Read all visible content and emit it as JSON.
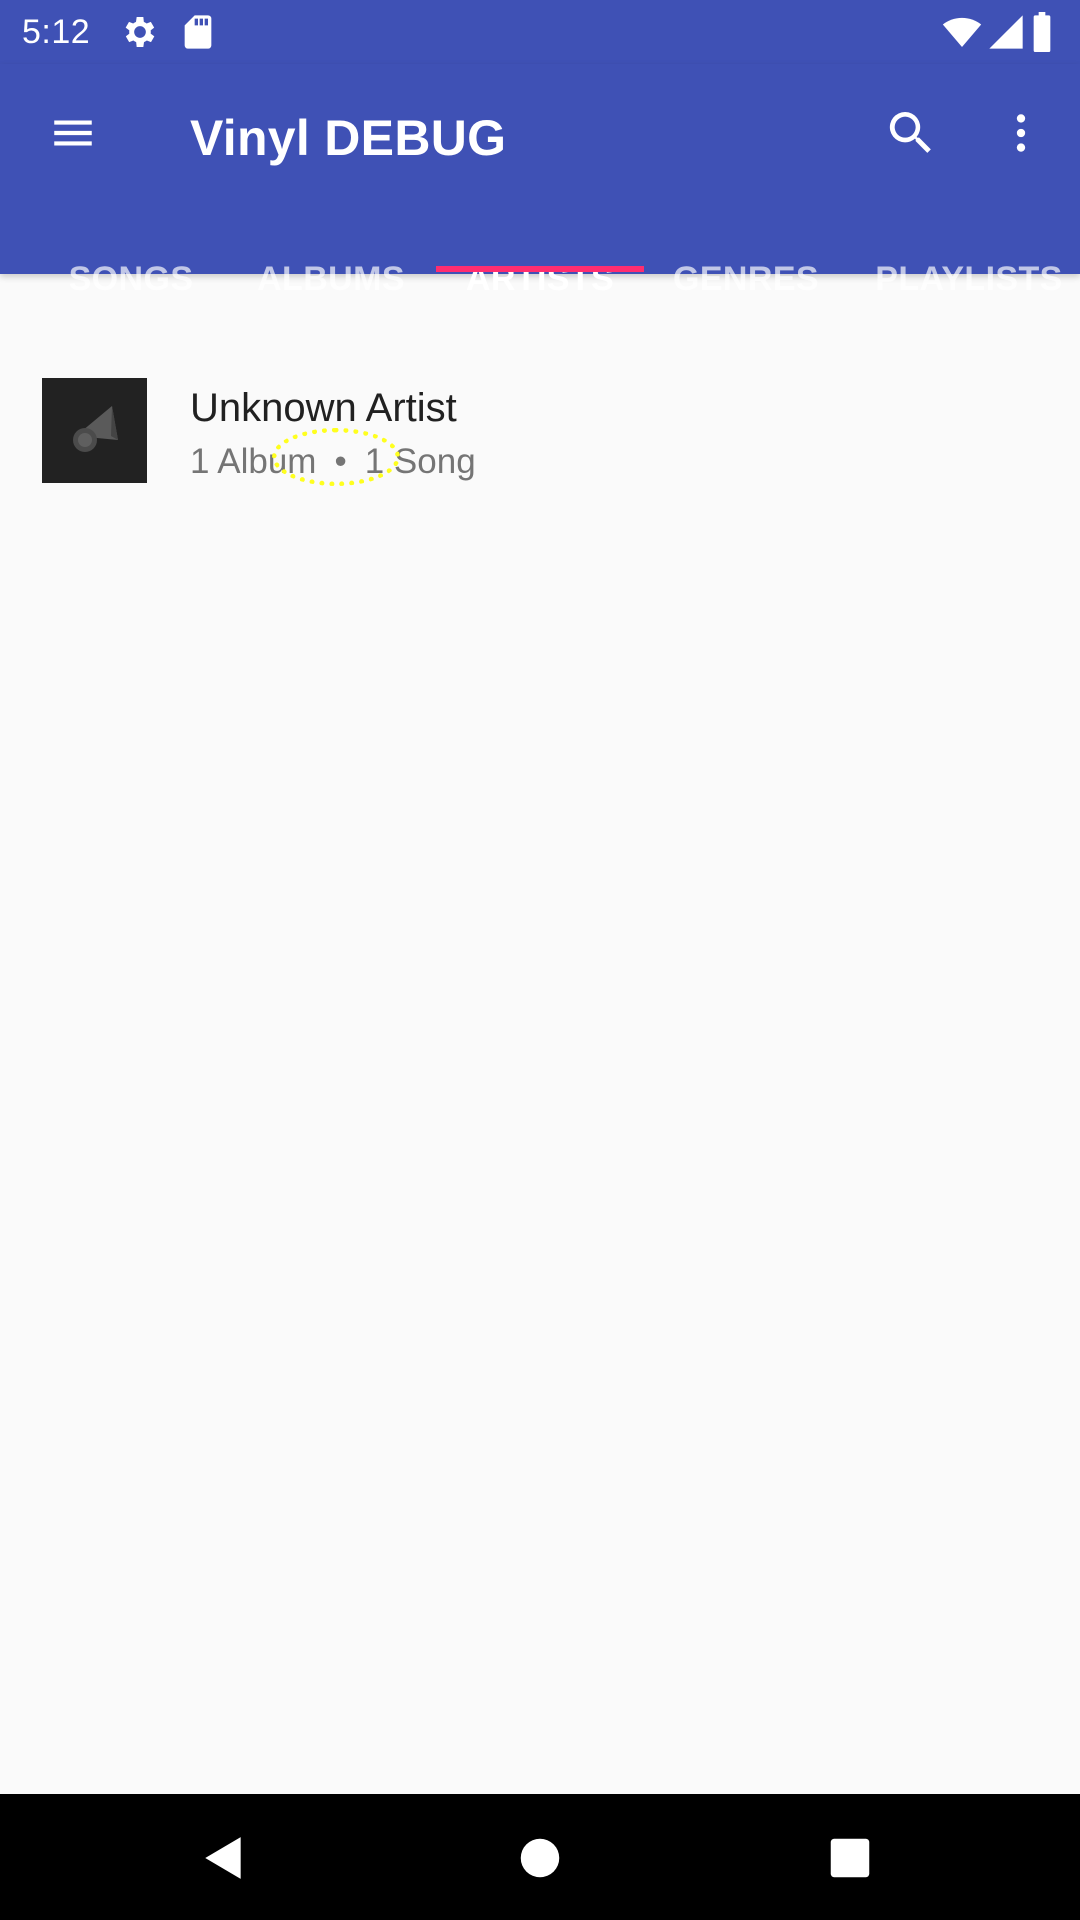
{
  "status_bar": {
    "time": "5:12",
    "icons": [
      "gear-icon",
      "sd-card-icon",
      "wifi-icon",
      "signal-icon",
      "battery-icon"
    ]
  },
  "app_bar": {
    "title": "Vinyl DEBUG",
    "icons": [
      "menu-icon",
      "search-icon",
      "more-vert-icon"
    ]
  },
  "tabs": [
    {
      "label": "SONGS",
      "active": false
    },
    {
      "label": "ALBUMS",
      "active": false
    },
    {
      "label": "ARTISTS",
      "active": true
    },
    {
      "label": "GENRES",
      "active": false
    },
    {
      "label": "PLAYLISTS",
      "active": false
    }
  ],
  "artists": [
    {
      "name": "Unknown Artist",
      "album_count": "1 Album",
      "separator": "•",
      "song_count": "1 Song",
      "thumbnail_icon": "gramophone-icon"
    }
  ],
  "nav_bar": {
    "icons": [
      "back-icon",
      "home-icon",
      "recents-icon"
    ]
  },
  "colors": {
    "primary": "#3f51b5",
    "accent": "#ff2d6f",
    "background": "#fafafa"
  }
}
